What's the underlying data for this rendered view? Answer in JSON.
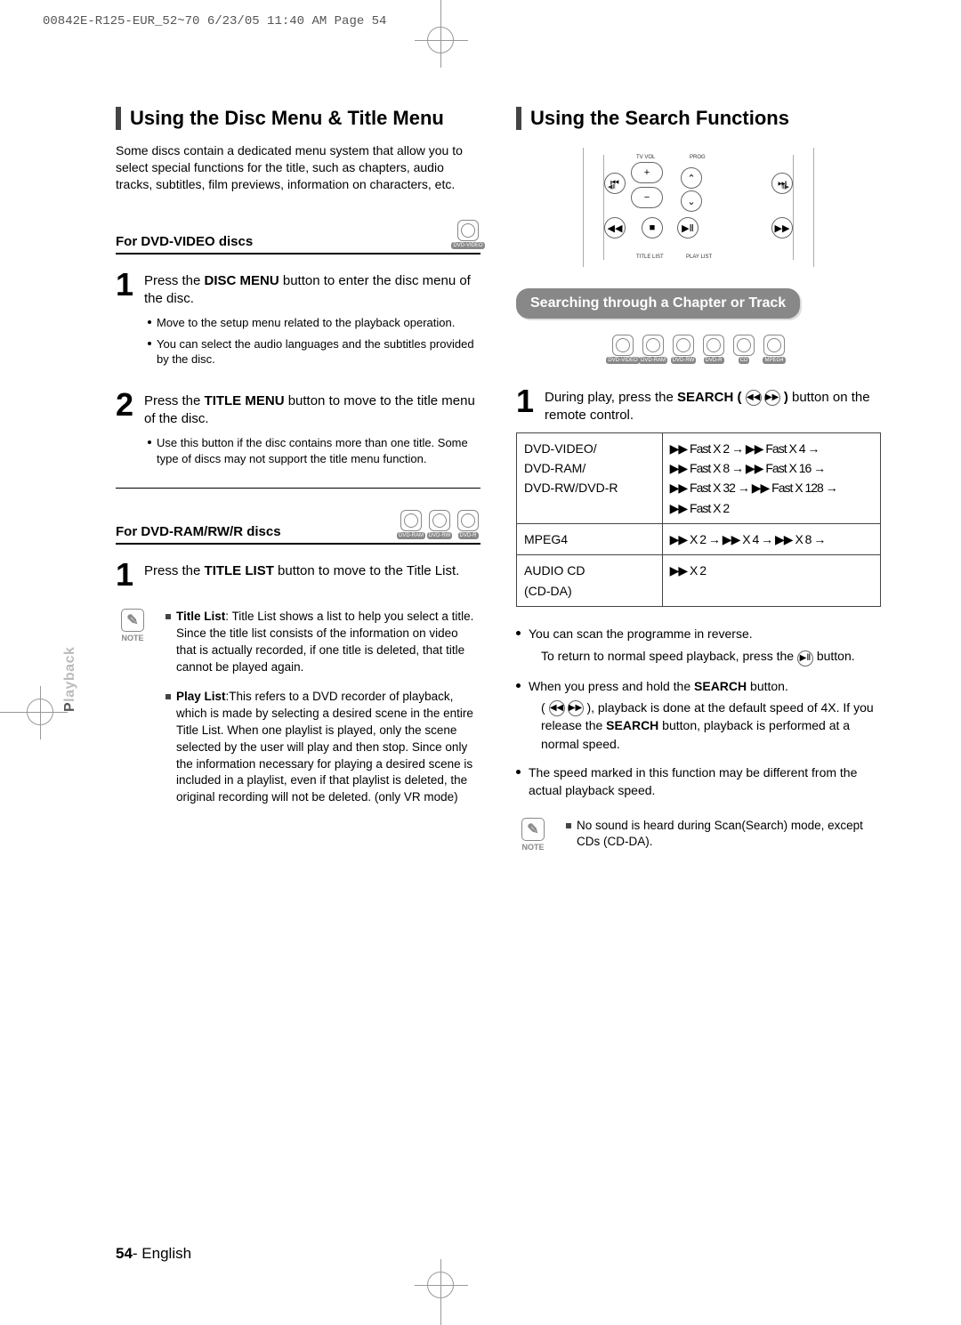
{
  "preprint": "00842E-R125-EUR_52~70  6/23/05  11:40 AM  Page 54",
  "left": {
    "title": "Using the Disc Menu & Title Menu",
    "intro": "Some discs contain a dedicated menu system that allow you to select special functions for the title, such as chapters, audio tracks, subtitles, film previews, information on characters, etc.",
    "sub1": "For DVD-VIDEO discs",
    "sub1_icons": [
      "DVD-VIDEO"
    ],
    "step1_pre": "Press the ",
    "step1_bold": "DISC MENU",
    "step1_post": " button to enter the disc menu of the disc.",
    "step1_b1": "Move to the setup menu related to the playback operation.",
    "step1_b2": "You can select the audio languages and the subtitles provided by the disc.",
    "step2_pre": "Press the ",
    "step2_bold": "TITLE MENU",
    "step2_post": " button to move to the title menu of the disc.",
    "step2_b1": "Use this button if the disc contains more than one title. Some type of discs may not support the title menu function.",
    "sub2": "For DVD-RAM/RW/R discs",
    "sub2_icons": [
      "DVD-RAM",
      "DVD-RW",
      "DVD-R"
    ],
    "step3_pre": "Press the ",
    "step3_bold": "TITLE LIST",
    "step3_post": " button to move to the Title List.",
    "note_label": "NOTE",
    "note1_bold": "Title List",
    "note1_text": ": Title List shows a list to help you select a title. Since the title list consists of the information on video that is actually recorded, if one title is deleted, that title cannot be played again.",
    "note2_bold": "Play List",
    "note2_text": ":This refers to a DVD recorder of playback, which is made by selecting a desired scene in the entire Title List. When one playlist is played, only the scene selected by the user will play and then stop. Since only the information necessary for playing a desired scene is included in a playlist, even if that playlist is deleted, the original recording will not be deleted. (only VR mode)"
  },
  "right": {
    "title": "Using the Search Functions",
    "remote_labels": {
      "tvvol": "TV VOL",
      "prog": "PROG",
      "titlelist": "TITLE LIST",
      "playlist": "PLAY LIST"
    },
    "pill": "Searching through a Chapter or Track",
    "disc_icons": [
      "DVD-VIDEO",
      "DVD-RAM",
      "DVD-RW",
      "DVD-R",
      "CD",
      "MPEG4"
    ],
    "step1_a": "During play, press the ",
    "step1_bold": "SEARCH (",
    "step1_b": " )",
    "step1_c": "button on the remote control.",
    "table": {
      "r1c1": "DVD-VIDEO/\nDVD-RAM/\nDVD-RW/DVD-R",
      "r1c2": "▶▶ Fast X 2 → ▶▶ Fast X 4 →\n▶▶ Fast X 8 → ▶▶ Fast X 16 →\n▶▶ Fast X 32 → ▶▶ Fast X 128 →\n▶▶ Fast X 2",
      "r2c1": "MPEG4",
      "r2c2": "▶▶  X 2 → ▶▶  X 4 → ▶▶  X 8 →",
      "r3c1": "AUDIO CD\n(CD-DA)",
      "r3c2": "▶▶  X 2"
    },
    "b1a": "You can scan the programme in reverse.",
    "b1b_pre": "To return to normal speed playback, press the ",
    "b1b_post": " button.",
    "b2a_pre": "When you press and hold the ",
    "b2a_bold": "SEARCH",
    "b2a_post": " button.",
    "b2b_pre": "( ",
    "b2b_mid": " ), playback is done at the default speed of 4X. If you release the ",
    "b2b_bold": "SEARCH",
    "b2b_post": " button, playback is performed at a normal speed.",
    "b3": "The speed marked in this function may be different from the actual playback speed.",
    "note_label": "NOTE",
    "note_text": "No sound is heard during Scan(Search) mode, except CDs (CD-DA)."
  },
  "side_label_light": "P",
  "side_label_dark": "layback",
  "footer_num": "54",
  "footer_txt": "- English"
}
